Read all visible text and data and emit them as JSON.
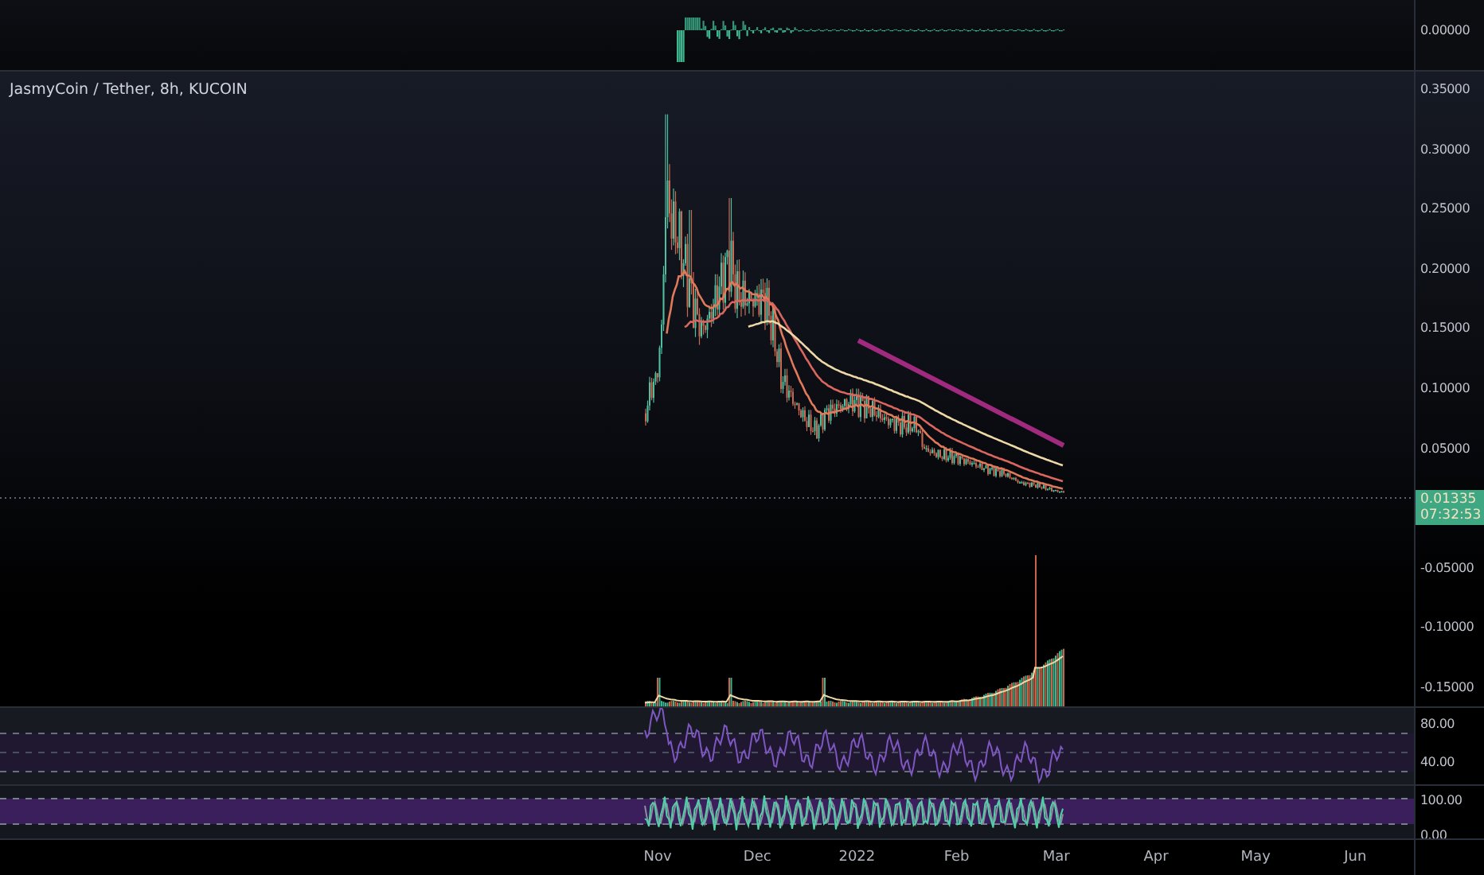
{
  "symbol_title": "JasmyCoin / Tether, 8h, KUCOIN",
  "top_pane": {
    "axis_labels": [
      "0.00000"
    ]
  },
  "main_pane": {
    "axis_labels": [
      "0.35000",
      "0.30000",
      "0.25000",
      "0.20000",
      "0.15000",
      "0.10000",
      "0.05000",
      "-0.05000",
      "-0.10000",
      "-0.15000"
    ],
    "last_price": {
      "price": "0.01335",
      "countdown": "07:32:53"
    }
  },
  "rsi_pane": {
    "axis_labels": [
      "80.00",
      "40.00"
    ]
  },
  "stoch_pane": {
    "axis_labels": [
      "100.00",
      "0.00"
    ]
  },
  "time_axis": [
    "Nov",
    "Dec",
    "2022",
    "Feb",
    "Mar",
    "Apr",
    "May",
    "Jun"
  ]
}
